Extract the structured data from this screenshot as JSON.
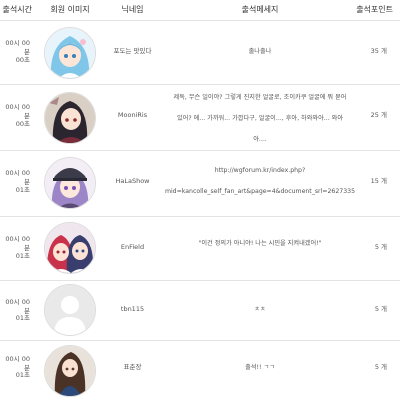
{
  "headers": {
    "time": "출석시간",
    "avatar": "회원 이미지",
    "nick": "닉네임",
    "message": "출석메세지",
    "points": "출석포인트"
  },
  "rows": [
    {
      "time1": "00시 00분",
      "time2": "00초",
      "nick": "포도는 맛있다",
      "message_lines": [
        "출나출나"
      ],
      "points": "35 개",
      "avatar": "anime-girl-blue-hair"
    },
    {
      "time1": "00시 00분",
      "time2": "00초",
      "nick": "MooniRis",
      "message_lines": [
        "제독, 무슨 일이야? 그렇게 진지한 얼굴로, 조이카쿠 얼굴에 뭐 묻어",
        "있어? 에... 가까워... 가깝다구, 얼굴이..., 후아, 하와와아... 와아",
        "아...."
      ],
      "points": "25 개",
      "avatar": "anime-girl-dark-hair"
    },
    {
      "time1": "00시 00분",
      "time2": "01초",
      "nick": "HaLaShow",
      "message_lines": [
        "http://wgforum.kr/index.php?",
        "mid=kancolle_self_fan_art&page=4&document_srl=2627335"
      ],
      "points": "15 개",
      "avatar": "anime-girl-purple-hair-cap"
    },
    {
      "time1": "00시 00분",
      "time2": "01초",
      "nick": "EnField",
      "message_lines": [
        "\"이건 정의가 아니야! 나는 시민을 지켜내겠어!\""
      ],
      "points": "5 개",
      "avatar": "anime-two-girls"
    },
    {
      "time1": "00시 00분",
      "time2": "01초",
      "nick": "tbn115",
      "message_lines": [
        "ㅊㅊ"
      ],
      "points": "5 개",
      "avatar": "default-user-silhouette"
    },
    {
      "time1": "00시 00분",
      "time2": "01초",
      "nick": "표춘장",
      "message_lines": [
        "출석!! ㄱㄱ"
      ],
      "points": "5 개",
      "avatar": "anime-girl-long-brown-hair"
    }
  ]
}
